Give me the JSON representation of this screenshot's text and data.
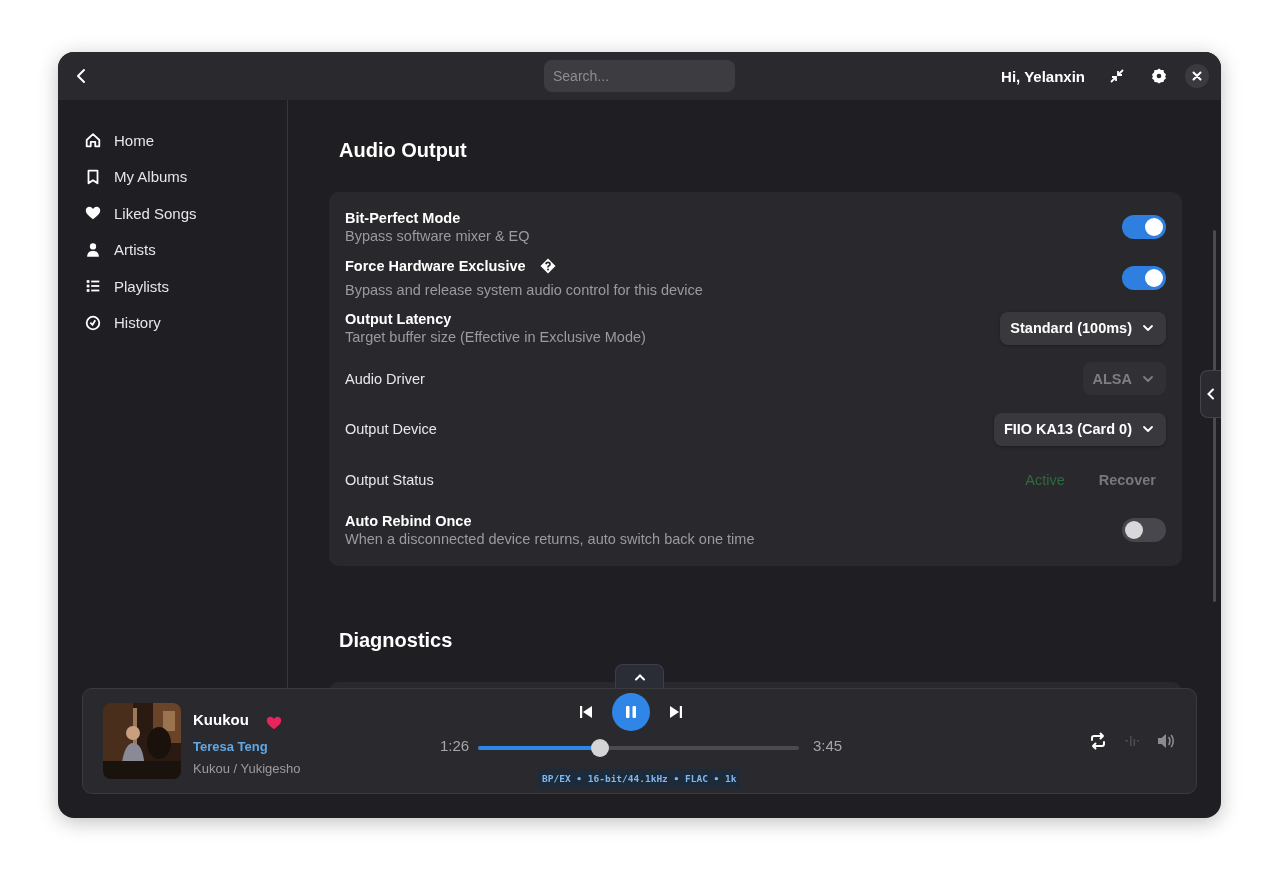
{
  "header": {
    "search": {
      "placeholder": "Search..."
    },
    "greeting": "Hi, Yelanxin"
  },
  "sidebar": {
    "items": [
      {
        "label": "Home",
        "selected": false
      },
      {
        "label": "My Albums",
        "selected": false
      },
      {
        "label": "Liked Songs",
        "selected": false
      },
      {
        "label": "Artists",
        "selected": false
      },
      {
        "label": "Playlists",
        "selected": false
      },
      {
        "label": "History",
        "selected": false
      }
    ]
  },
  "audio_output": {
    "title": "Audio Output",
    "rows": [
      {
        "kind": "toggle",
        "title": "Bit-Perfect Mode",
        "emphasis": true,
        "subtitle": "Bypass software mixer & EQ",
        "on": true
      },
      {
        "kind": "toggle",
        "title": "Force Hardware Exclusive",
        "emphasis": true,
        "has_help": true,
        "subtitle": "Bypass and release system audio control for this device",
        "on": true
      },
      {
        "kind": "select",
        "title": "Output Latency",
        "emphasis": true,
        "subtitle": "Target buffer size (Effective in Exclusive Mode)",
        "value": "Standard (100ms)",
        "disabled": false
      },
      {
        "kind": "select",
        "title": "Audio Driver",
        "emphasis": false,
        "value": "ALSA",
        "disabled": true
      },
      {
        "kind": "select",
        "title": "Output Device",
        "emphasis": false,
        "value": "FIIO KA13 (Card 0)",
        "disabled": false
      },
      {
        "kind": "status",
        "title": "Output Status",
        "emphasis": false,
        "status": "Active",
        "action": "Recover",
        "action_disabled": true
      },
      {
        "kind": "toggle",
        "title": "Auto Rebind Once",
        "emphasis": true,
        "subtitle": "When a disconnected device returns, auto switch back one time",
        "on": false
      }
    ]
  },
  "diagnostics": {
    "title": "Diagnostics"
  },
  "player": {
    "title": "Kuukou",
    "liked": true,
    "artist": "Teresa Teng",
    "album": "Kukou / Yukigesho",
    "playing": true,
    "elapsed": "1:26",
    "duration": "3:45",
    "level": 0.38,
    "format": "BP/EX • 16-bit/44.1kHz • FLAC • 1k"
  }
}
